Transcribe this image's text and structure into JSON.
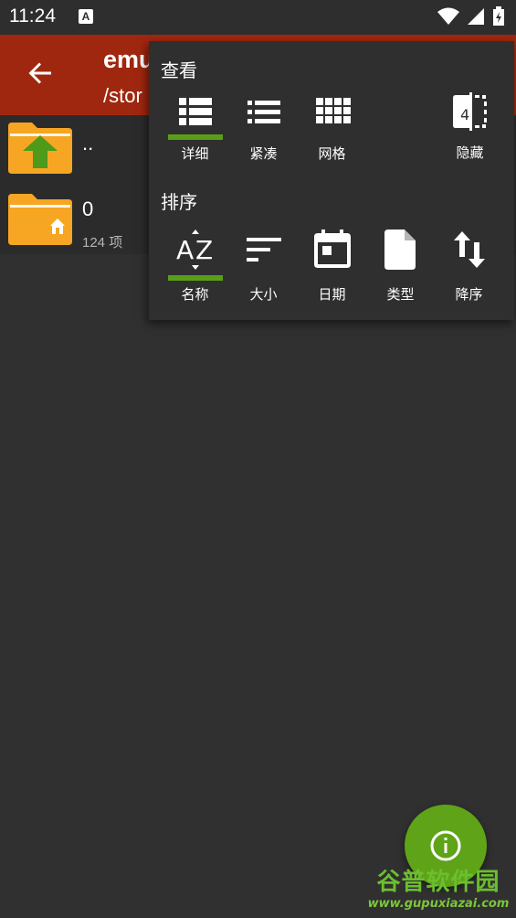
{
  "status_bar": {
    "time": "11:24",
    "app_indicator": "A"
  },
  "app_bar": {
    "title": "emu",
    "path": "/stor"
  },
  "files": [
    {
      "name": "..",
      "meta": ""
    },
    {
      "name": "0",
      "meta": "124 项"
    }
  ],
  "view_menu": {
    "view_section": "查看",
    "view_options": [
      {
        "label": "详细",
        "selected": true
      },
      {
        "label": "紧凑",
        "selected": false
      },
      {
        "label": "网格",
        "selected": false
      },
      {
        "label": "隐藏",
        "selected": false
      }
    ],
    "sort_section": "排序",
    "sort_options": [
      {
        "label": "名称",
        "selected": true
      },
      {
        "label": "大小",
        "selected": false
      },
      {
        "label": "日期",
        "selected": false
      },
      {
        "label": "类型",
        "selected": false
      },
      {
        "label": "降序",
        "selected": false
      }
    ]
  },
  "fab": {
    "icon": "info-icon"
  },
  "watermark": {
    "top": "谷普软件园",
    "bottom": "www.gupuxiazai.com"
  },
  "colors": {
    "app_bar": "#a0270f",
    "accent": "#5a9e18",
    "folder": "#f6a623",
    "fab": "#5fa318"
  }
}
